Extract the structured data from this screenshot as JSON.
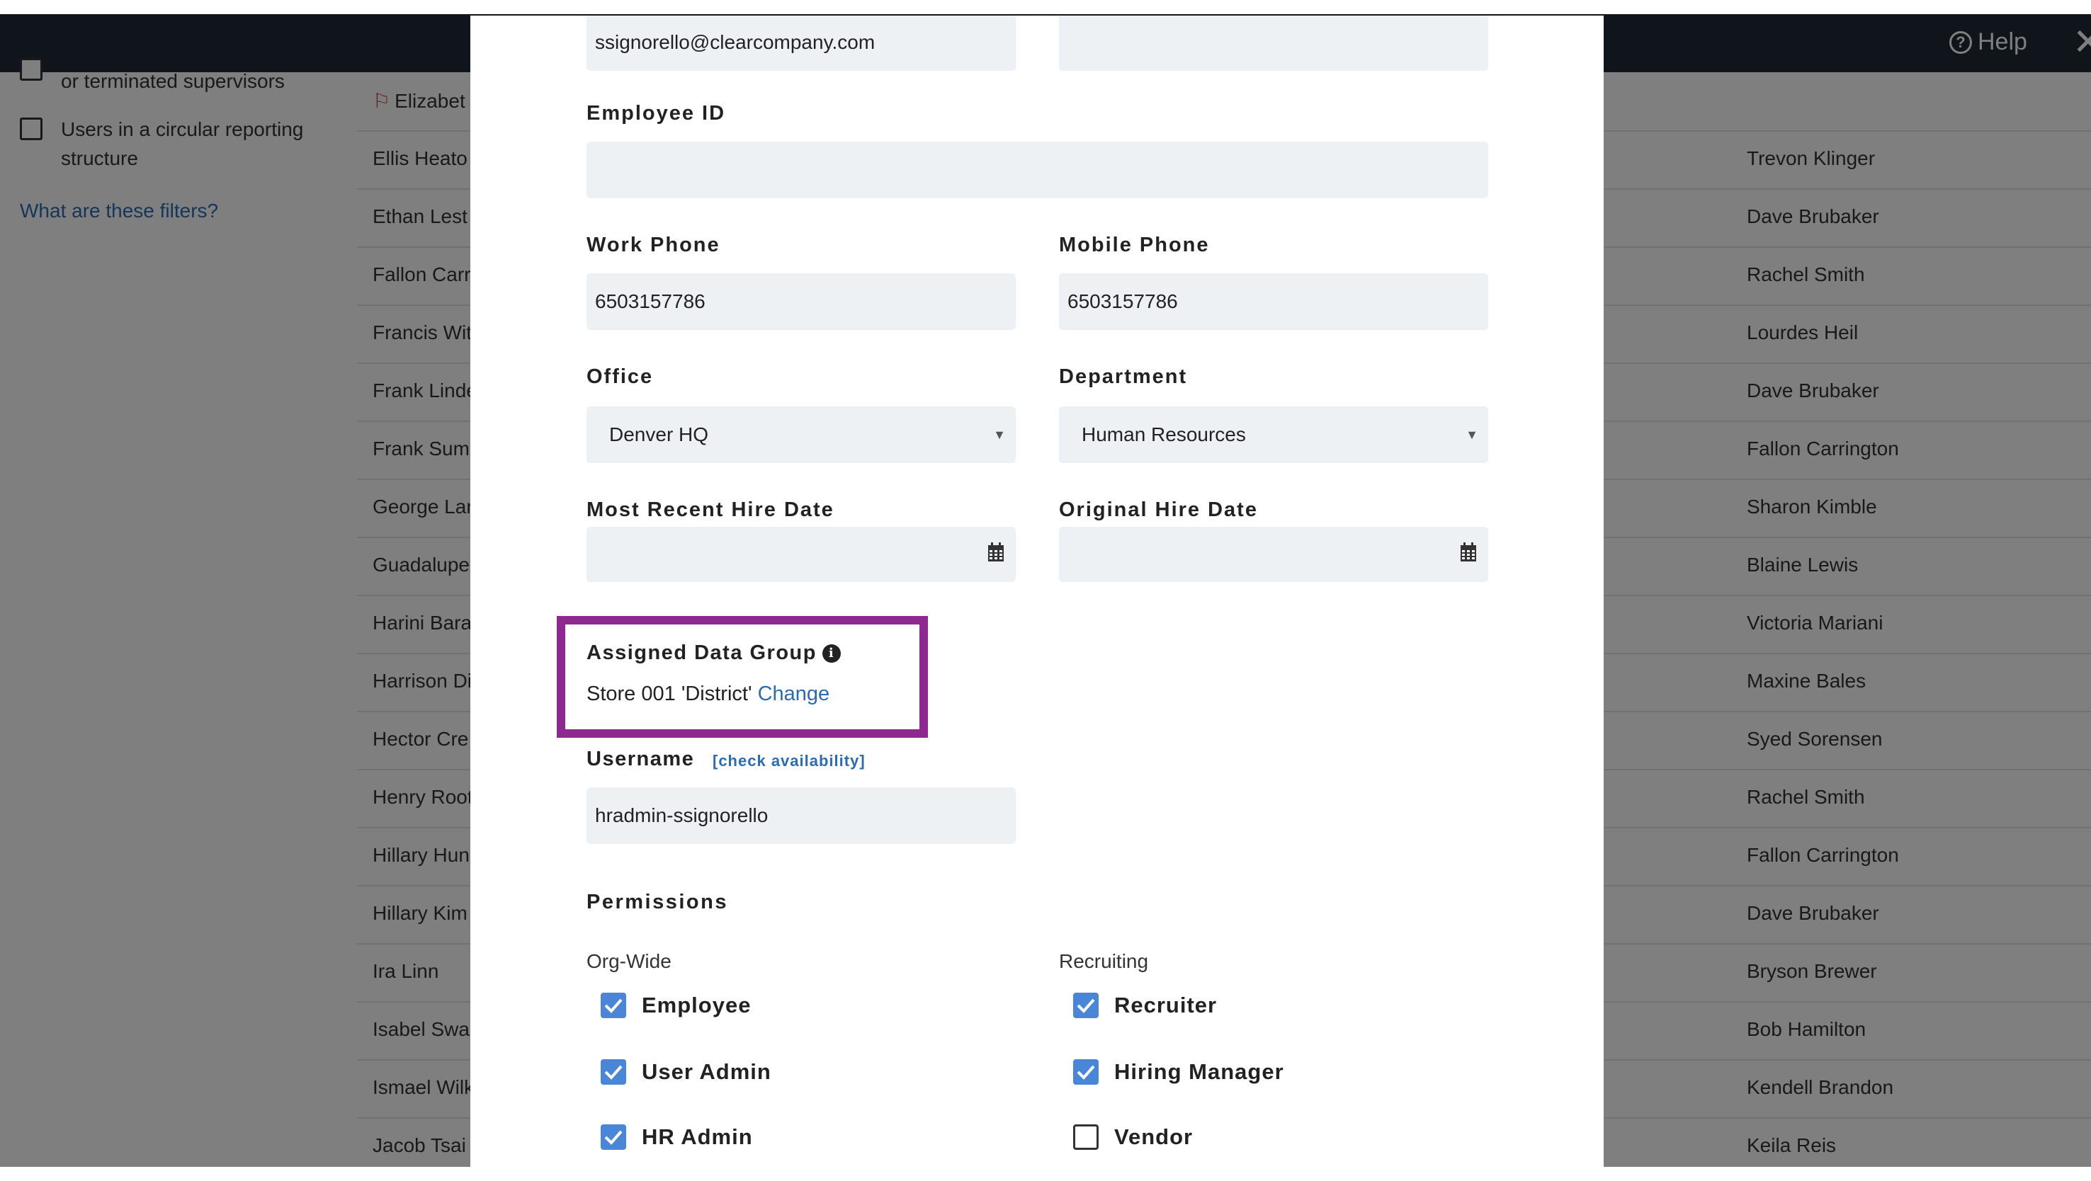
{
  "header": {
    "help_label": "Help",
    "close_glyph": "✕"
  },
  "filters": {
    "item1_label": "or terminated supervisors",
    "item2_label": "Users in a circular reporting structure",
    "link": "What are these filters?"
  },
  "table": {
    "rows": [
      {
        "name": "Elizabet",
        "supervisor": ""
      },
      {
        "name": "Ellis Heato",
        "supervisor": "Trevon Klinger"
      },
      {
        "name": "Ethan Lest",
        "supervisor": "Dave Brubaker"
      },
      {
        "name": "Fallon Carr",
        "supervisor": "Rachel Smith"
      },
      {
        "name": "Francis Wit",
        "supervisor": "Lourdes Heil"
      },
      {
        "name": "Frank Linde",
        "supervisor": "Dave Brubaker"
      },
      {
        "name": "Frank Sum",
        "supervisor": "Fallon Carrington"
      },
      {
        "name": "George Lar",
        "supervisor": "Sharon Kimble"
      },
      {
        "name": "Guadalupe",
        "supervisor": "Blaine Lewis"
      },
      {
        "name": "Harini Bara",
        "supervisor": "Victoria Mariani"
      },
      {
        "name": "Harrison Di",
        "supervisor": "Maxine Bales"
      },
      {
        "name": "Hector Cre",
        "supervisor": "Syed Sorensen"
      },
      {
        "name": "Henry Root",
        "supervisor": "Rachel Smith"
      },
      {
        "name": "Hillary Hun",
        "supervisor": "Fallon Carrington"
      },
      {
        "name": "Hillary Kim",
        "supervisor": "Dave Brubaker"
      },
      {
        "name": "Ira Linn",
        "supervisor": "Bryson Brewer"
      },
      {
        "name": "Isabel Swa",
        "supervisor": "Bob Hamilton"
      },
      {
        "name": "Ismael Wilk",
        "supervisor": "Kendell Brandon"
      },
      {
        "name": "Jacob Tsai",
        "supervisor": "Keila Reis"
      }
    ]
  },
  "modal": {
    "email_value": "ssignorello@clearcompany.com",
    "email_right_value": "",
    "employee_id": {
      "label": "Employee ID",
      "value": ""
    },
    "work_phone": {
      "label": "Work Phone",
      "value": "6503157786"
    },
    "mobile_phone": {
      "label": "Mobile Phone",
      "value": "6503157786"
    },
    "office": {
      "label": "Office",
      "value": "Denver HQ"
    },
    "department": {
      "label": "Department",
      "value": "Human Resources"
    },
    "recent_hire": {
      "label": "Most Recent Hire Date",
      "value": ""
    },
    "original_hire": {
      "label": "Original Hire Date",
      "value": ""
    },
    "data_group": {
      "label": "Assigned Data Group",
      "value": "Store 001 'District'",
      "change_link": "Change"
    },
    "username": {
      "label": "Username",
      "check_link": "[check availability]",
      "value": "hradmin-ssignorello"
    },
    "permissions": {
      "title": "Permissions",
      "org_wide_title": "Org-Wide",
      "recruiting_title": "Recruiting",
      "org_wide": [
        {
          "label": "Employee",
          "checked": true
        },
        {
          "label": "User Admin",
          "checked": true
        },
        {
          "label": "HR Admin",
          "checked": true
        }
      ],
      "recruiting": [
        {
          "label": "Recruiter",
          "checked": true
        },
        {
          "label": "Hiring Manager",
          "checked": true
        },
        {
          "label": "Vendor",
          "checked": false
        }
      ]
    }
  },
  "colors": {
    "highlight_border": "#8e2a8f",
    "checkbox_checked": "#4a86d8",
    "link": "#2b6cb0",
    "field_bg": "#eef1f4",
    "topbar": "#1f2a35"
  }
}
